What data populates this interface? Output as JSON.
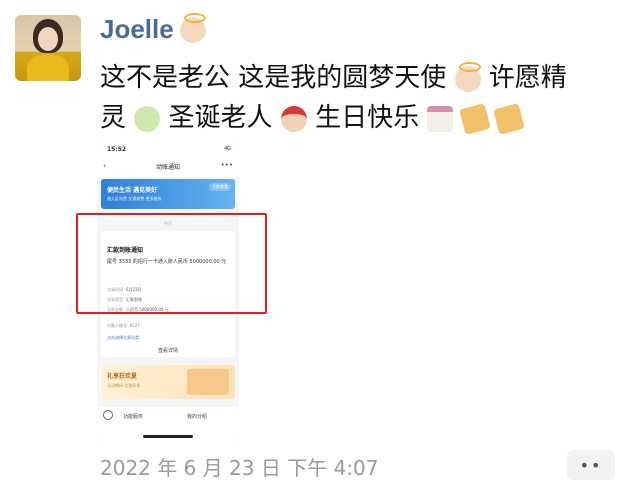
{
  "post": {
    "username": "Joelle",
    "name_emoji": "angel-emoji",
    "message": {
      "line1_part1": "这不是老公 这是我的圆梦天使",
      "line1_part2": "许愿精",
      "line2_part1": "灵",
      "line2_part2": "圣诞老人",
      "line2_part3": "生日快乐"
    },
    "timestamp": "2022 年 6 月 23 日  下午 4:07",
    "more_button": "••"
  },
  "screenshot": {
    "status_time": "15:52",
    "status_signal": "4G",
    "nav_back": "‹",
    "nav_title": "动账通知",
    "nav_more": "•••",
    "banner_title": "便民生活 遇见美好",
    "banner_subtitle": "缴九区电费 交通缴费 更多服务",
    "banner_tag": "立即查看",
    "card_small_label": "今天",
    "card_title": "汇款到账通知",
    "card_body": "尾号 3333 的招行一卡通入账人民币 5000000.00 元",
    "rows": [
      {
        "key": "交易时间",
        "value": "6月23日"
      },
      {
        "key": "交易类型",
        "value": "汇款到账"
      },
      {
        "key": "交易金额",
        "value": "人民币 5000000.00 元"
      }
    ],
    "account": "付款人账号: 8227",
    "link": "点击选择交易分类",
    "detail": "查看详情",
    "promo_title": "礼享狂欢夏",
    "promo_subtitle": "活动期间 优惠多多",
    "tab1": "功能服务",
    "tab2": "我的分组"
  },
  "colors": {
    "username": "#4a6a9a",
    "highlight_border": "#e0211b",
    "timestamp": "#9a9a9a"
  }
}
